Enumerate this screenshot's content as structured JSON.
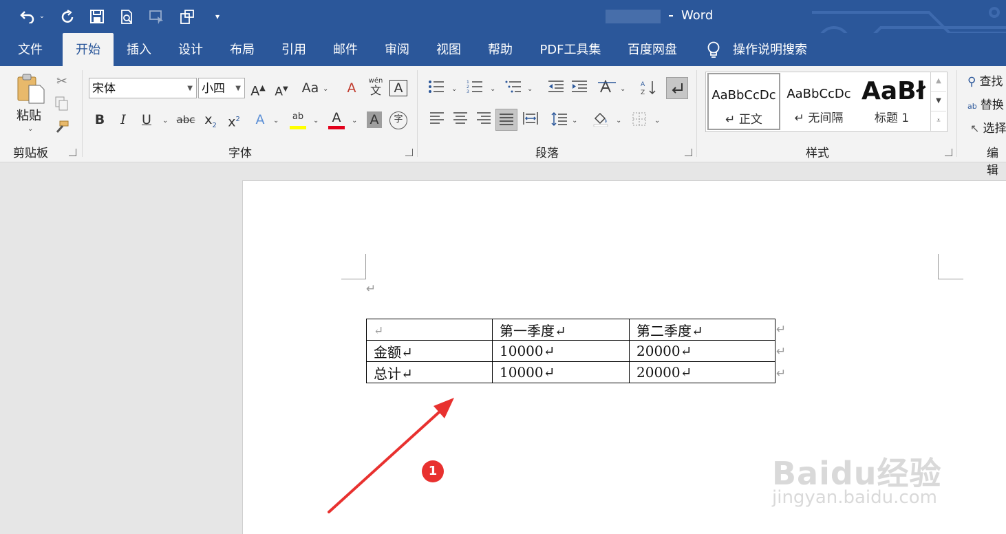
{
  "window": {
    "app_name": "Word"
  },
  "quick_access": {
    "customize_label": "▾"
  },
  "tabs": [
    {
      "label": "文件"
    },
    {
      "label": "开始"
    },
    {
      "label": "插入"
    },
    {
      "label": "设计"
    },
    {
      "label": "布局"
    },
    {
      "label": "引用"
    },
    {
      "label": "邮件"
    },
    {
      "label": "审阅"
    },
    {
      "label": "视图"
    },
    {
      "label": "帮助"
    },
    {
      "label": "PDF工具集"
    },
    {
      "label": "百度网盘"
    }
  ],
  "tell_me": {
    "label": "操作说明搜索"
  },
  "ribbon": {
    "clipboard": {
      "paste_label": "粘贴",
      "group_label": "剪贴板"
    },
    "font": {
      "font_name": "宋体",
      "font_size": "小四",
      "group_label": "字体",
      "case_label": "Aa",
      "wen_label": "wén",
      "wen_char": "文"
    },
    "paragraph": {
      "group_label": "段落"
    },
    "styles": {
      "group_label": "样式",
      "items": [
        {
          "sample": "AaBbCcDc",
          "name": "↵ 正文"
        },
        {
          "sample": "AaBbCcDc",
          "name": "↵ 无间隔"
        },
        {
          "sample": "AaBł",
          "name": "标题 1"
        }
      ]
    },
    "editing": {
      "find_label": "查找",
      "replace_label": "替换",
      "select_label": "选择",
      "group_label": "编辑"
    }
  },
  "document": {
    "empty_paragraph_mark": "↵",
    "table": {
      "rows": [
        [
          "↵",
          "第一季度↵",
          "第二季度↵"
        ],
        [
          "金额↵",
          "10000↵",
          "20000↵"
        ],
        [
          "总计↵",
          "10000↵",
          "20000↵"
        ]
      ],
      "row_end_mark": "↵"
    }
  },
  "annotation": {
    "step_number": "1"
  },
  "watermark": {
    "brand": "Baidu经验",
    "url": "jingyan.baidu.com"
  },
  "colors": {
    "title_bar": "#2b579a",
    "ribbon": "#f3f3f3",
    "annotation_red": "#e8312f"
  }
}
